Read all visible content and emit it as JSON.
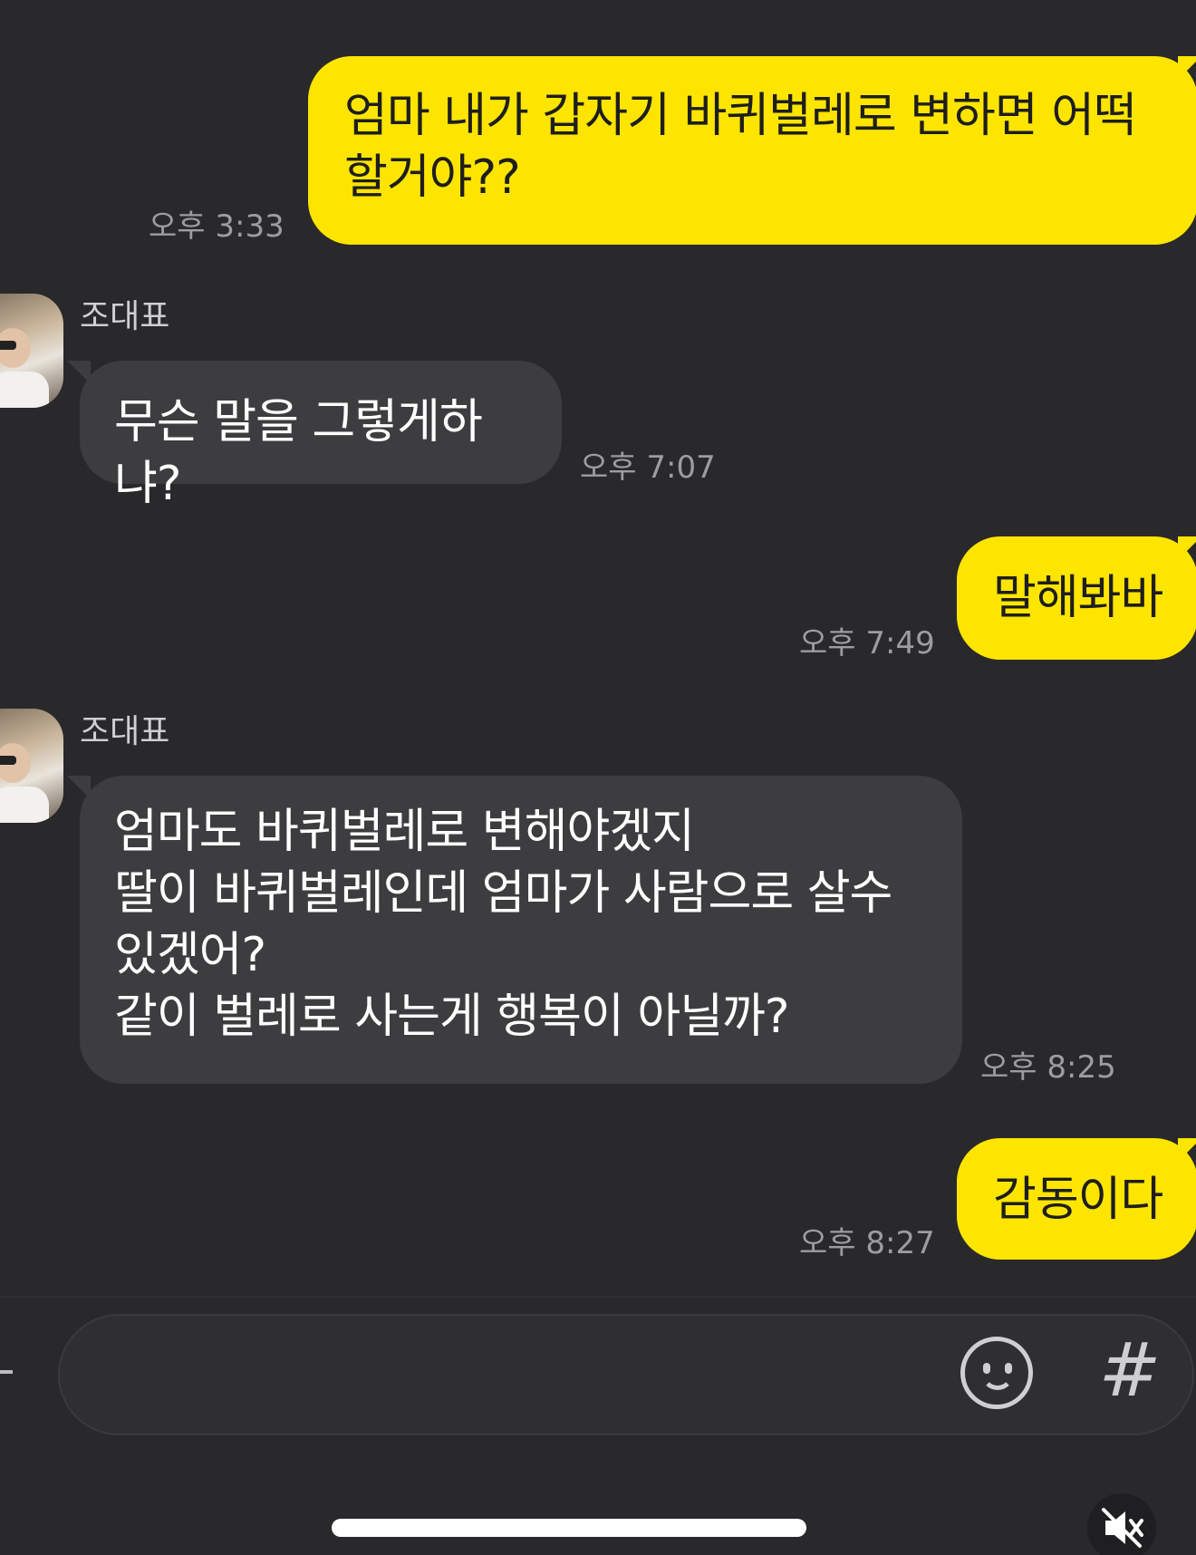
{
  "messages": [
    {
      "side": "me",
      "text": "엄마 내가 갑자기 바퀴벌레로 변하면 어떡\n할거야??",
      "time": "오후 3:33"
    },
    {
      "side": "other",
      "sender": "조대표",
      "text": "무슨 말을 그렇게하냐?",
      "time": "오후 7:07"
    },
    {
      "side": "me",
      "text": "말해봐바",
      "time": "오후 7:49"
    },
    {
      "side": "other",
      "sender": "조대표",
      "text": "엄마도 바퀴벌레로 변해야겠지\n딸이 바퀴벌레인데 엄마가 사람으로 살수\n있겠어?\n같이 벌레로 사는게 행복이 아닐까?",
      "time": "오후 8:25"
    },
    {
      "side": "me",
      "text": "감동이다",
      "time": "오후 8:27"
    }
  ],
  "input": {
    "value": "",
    "hash_label": "#"
  },
  "icons": {
    "emoji": "emoji-icon",
    "hash": "hashtag-icon",
    "mute": "mute-icon",
    "plus": "plus-icon"
  },
  "colors": {
    "my_bubble": "#fee500",
    "other_bubble": "#3d3d40",
    "background": "#29292b"
  }
}
